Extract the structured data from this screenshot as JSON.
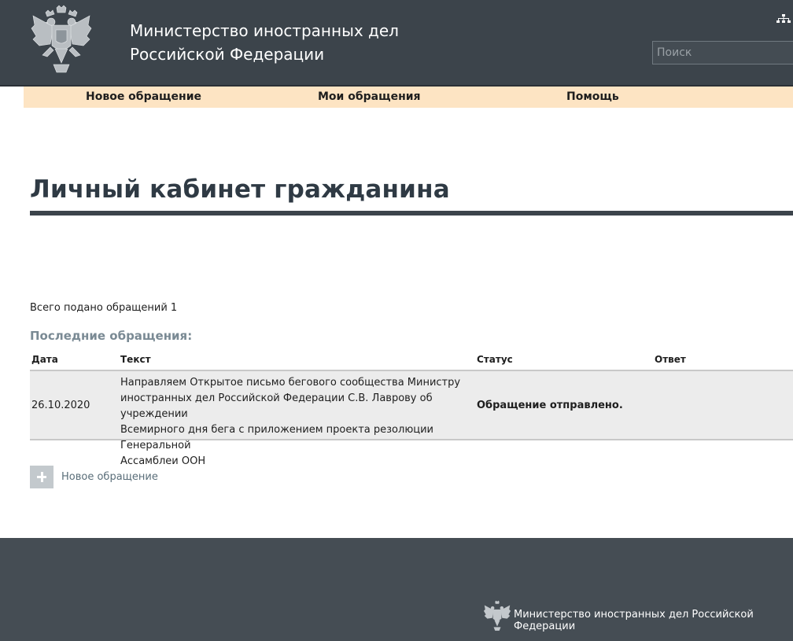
{
  "header": {
    "title_line1": "Министерство иностранных дел",
    "title_line2": "Российской Федерации",
    "search_placeholder": "Поиск"
  },
  "nav": {
    "items": [
      {
        "label": "Новое обращение"
      },
      {
        "label": "Мои обращения"
      },
      {
        "label": "Помощь"
      }
    ]
  },
  "main": {
    "page_title": "Личный кабинет гражданина",
    "total_text": "Всего подано обращений 1",
    "recent_heading": "Последние обращения:",
    "table": {
      "columns": [
        "Дата",
        "Текст",
        "Статус",
        "Ответ"
      ],
      "rows": [
        {
          "date": "26.10.2020",
          "text_lines": [
            "Направляем Открытое письмо бегового сообщества Министру",
            "иностранных дел Российской Федерации С.В. Лаврову об учреждении",
            "Всемирного дня бега с приложением проекта резолюции Генеральной",
            "Ассамблеи ООН"
          ],
          "status": "Обращение отправлено.",
          "answer": ""
        }
      ]
    },
    "new_request_label": "Новое обращение"
  },
  "footer": {
    "text": "Министерство иностранных дел Российской Федерации"
  },
  "colors": {
    "header_bg": "#3c444b",
    "nav_bg": "#fde4c3",
    "footer_bg": "#454d54",
    "row_bg": "#ececec",
    "heading_muted": "#7a8a94"
  },
  "icons": {
    "emblem": "double-headed-eagle-emblem",
    "sitemap": "sitemap-icon",
    "add": "plus-icon"
  }
}
